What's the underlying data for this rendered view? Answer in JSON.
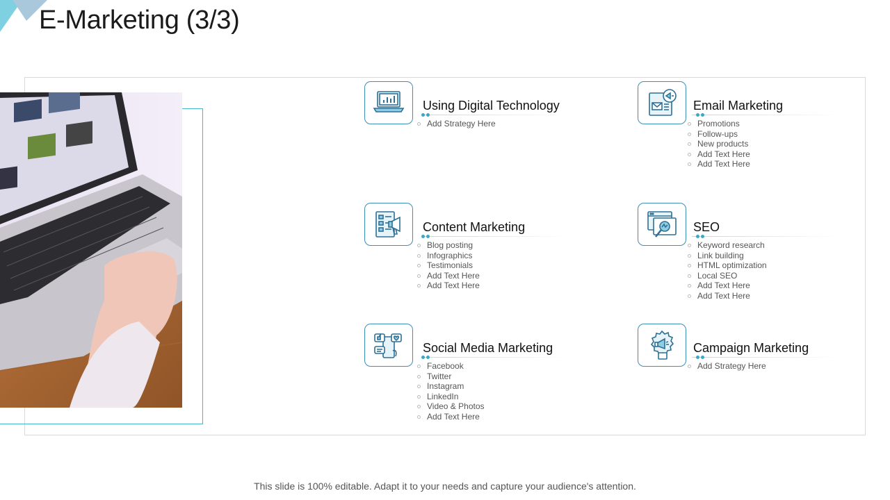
{
  "title": "E-Marketing (3/3)",
  "footer": "This slide is 100% editable. Adapt it to your needs and capture your audience's attention.",
  "colors": {
    "accent": "#3ca7c7",
    "icon_stroke": "#2d6f96",
    "border": "#d9d9d9"
  },
  "cards": [
    {
      "title": "Using Digital Technology",
      "icon": "laptop-chart-icon",
      "items": [
        "Add Strategy Here"
      ]
    },
    {
      "title": "Email Marketing",
      "icon": "email-megaphone-icon",
      "items": [
        "Promotions",
        "Follow-ups",
        "New products",
        "Add Text Here",
        "Add Text Here"
      ]
    },
    {
      "title": "Content Marketing",
      "icon": "content-megaphone-icon",
      "items": [
        "Blog posting",
        "Infographics",
        "Testimonials",
        "Add Text Here",
        "Add Text Here"
      ]
    },
    {
      "title": "SEO",
      "icon": "seo-browser-search-icon",
      "items": [
        "Keyword research",
        "Link building",
        "HTML optimization",
        "Local SEO",
        "Add Text Here",
        "Add Text Here"
      ]
    },
    {
      "title": "Social Media Marketing",
      "icon": "social-media-icon",
      "items": [
        "Facebook",
        "Twitter",
        "Instagram",
        "LinkedIn",
        "Video & Photos",
        "Add Text Here"
      ]
    },
    {
      "title": "Campaign Marketing",
      "icon": "campaign-badge-icon",
      "items": [
        "Add Strategy Here"
      ]
    }
  ]
}
